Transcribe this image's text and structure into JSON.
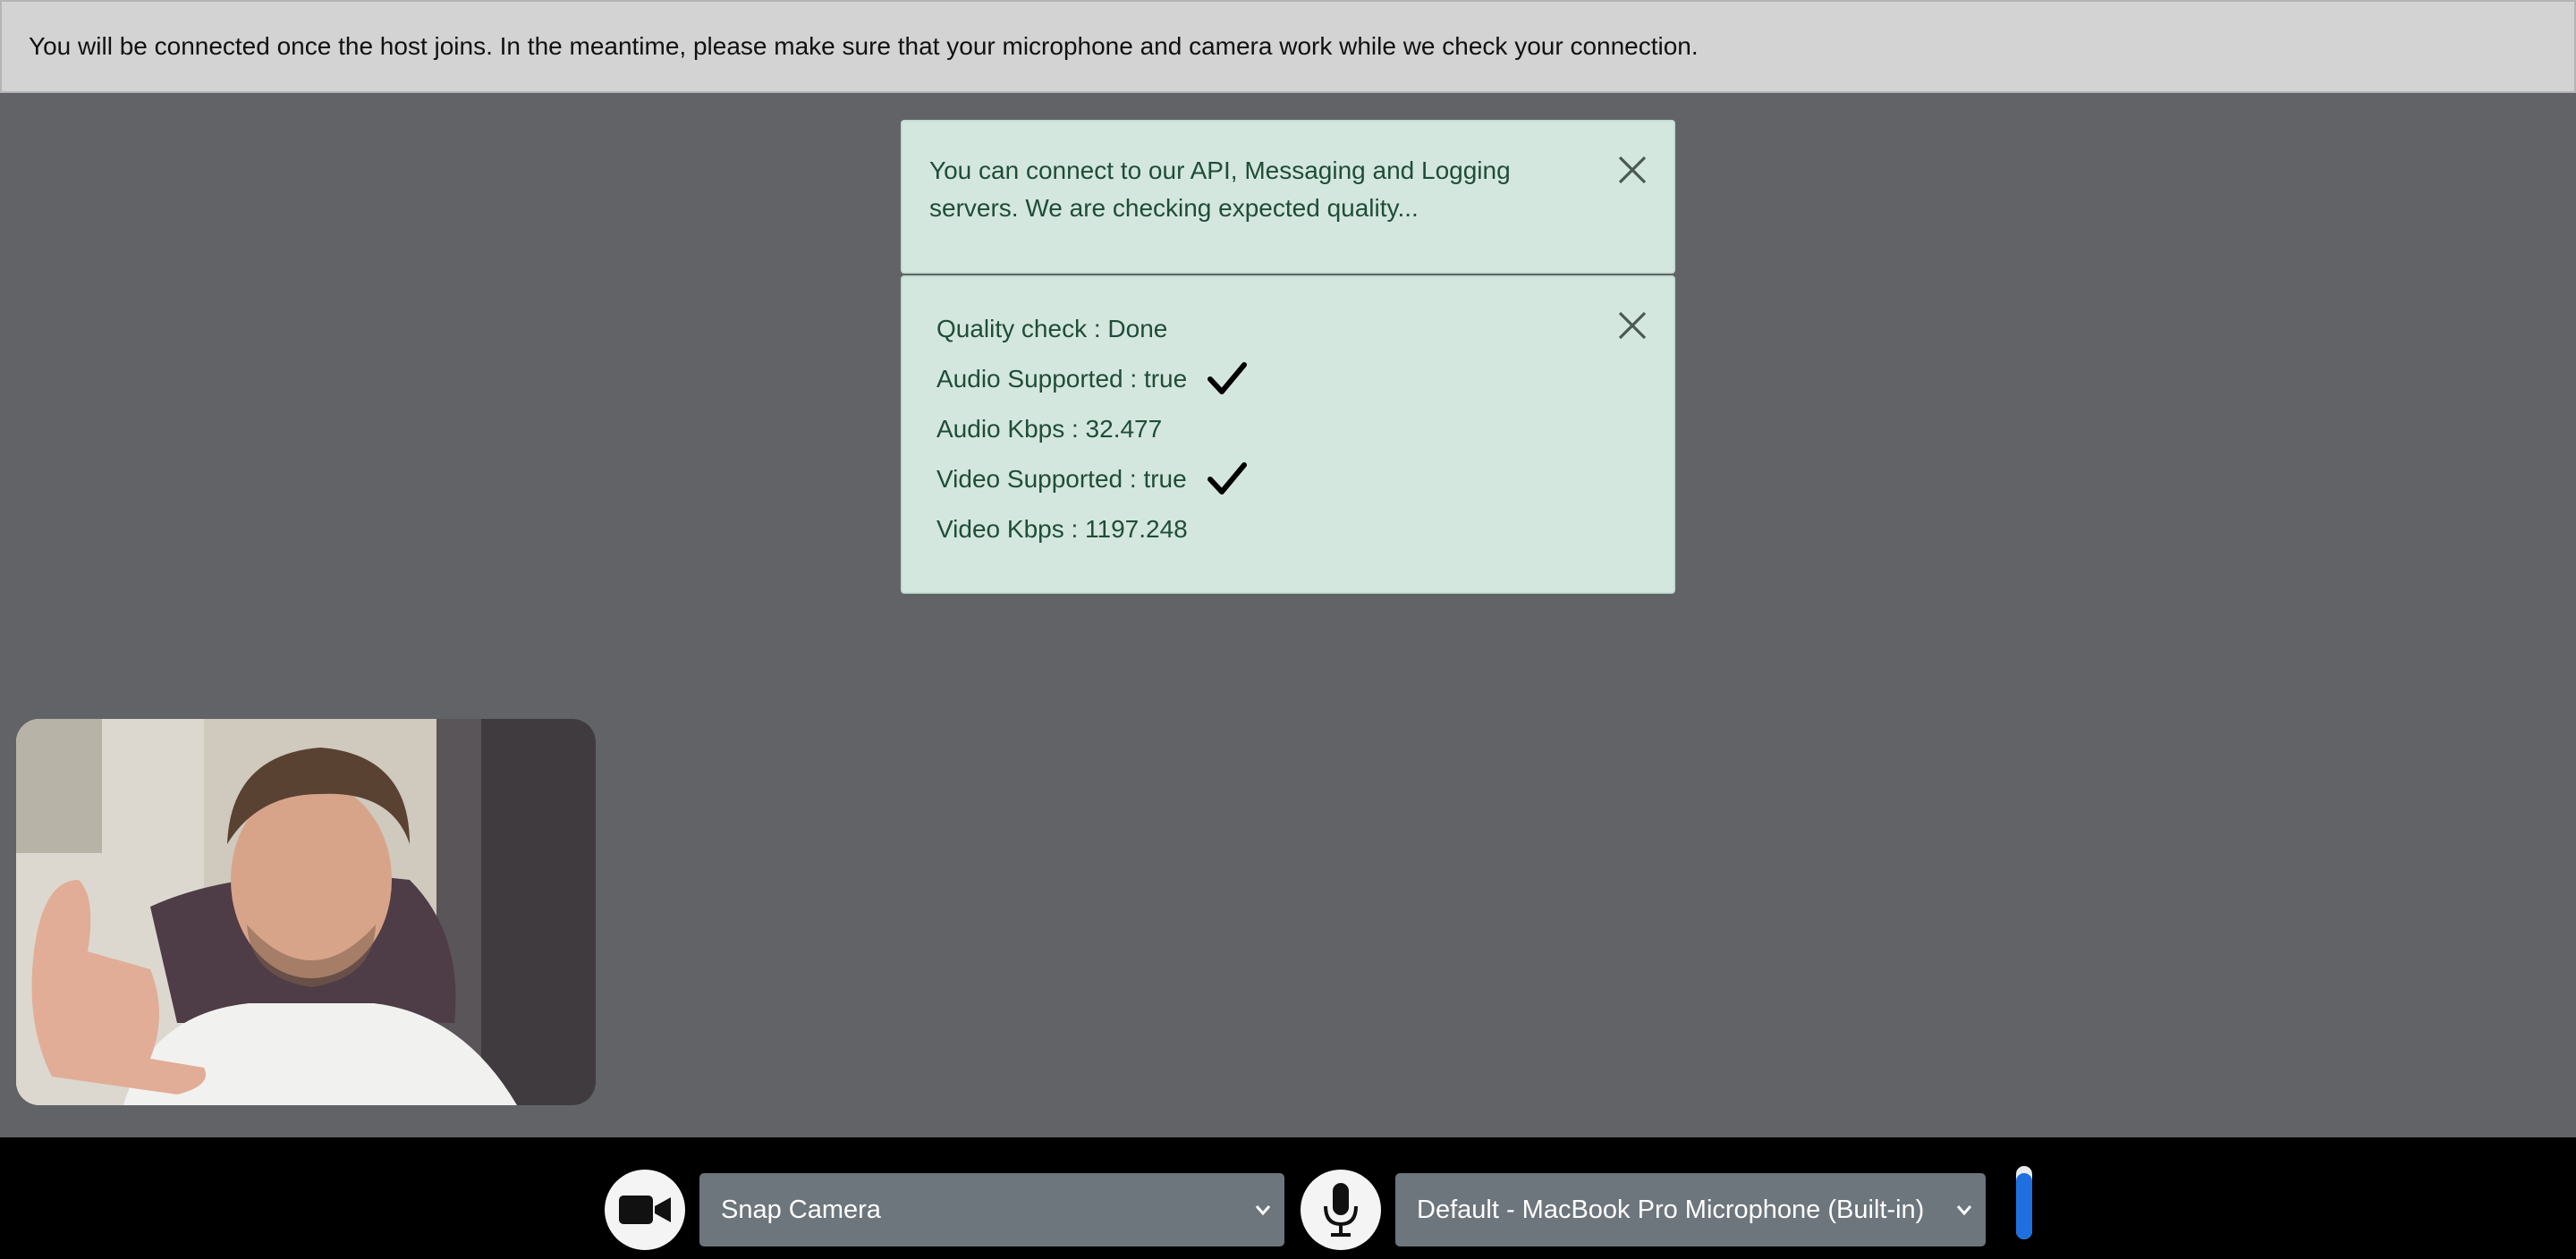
{
  "banner": {
    "message": "You will be connected once the host joins. In the meantime, please make sure that your microphone and camera work while we check your connection."
  },
  "connectivity_alert": {
    "message": "You can connect to our API, Messaging and Logging servers. We are checking expected quality...",
    "close_icon": "close-icon"
  },
  "quality_alert": {
    "close_icon": "close-icon",
    "rows": [
      {
        "label": "Quality check : Done",
        "check": false
      },
      {
        "label": "Audio Supported : true",
        "check": true
      },
      {
        "label": "Audio Kbps : 32.477",
        "check": false
      },
      {
        "label": "Video Supported : true",
        "check": true
      },
      {
        "label": "Video Kbps : 1197.248",
        "check": false
      }
    ]
  },
  "controls": {
    "camera_icon": "video-camera-icon",
    "camera_select": "Snap Camera",
    "mic_icon": "microphone-icon",
    "mic_select": "Default - MacBook Pro Microphone (Built-in)",
    "mic_level_fraction": 0.9
  },
  "colors": {
    "page_bg": "#616366",
    "banner_bg": "#d3d3d3",
    "alert_bg": "#d4e7df",
    "alert_text": "#1f4d37",
    "select_bg": "#6d757d",
    "level_fill": "#1f6fe0"
  }
}
